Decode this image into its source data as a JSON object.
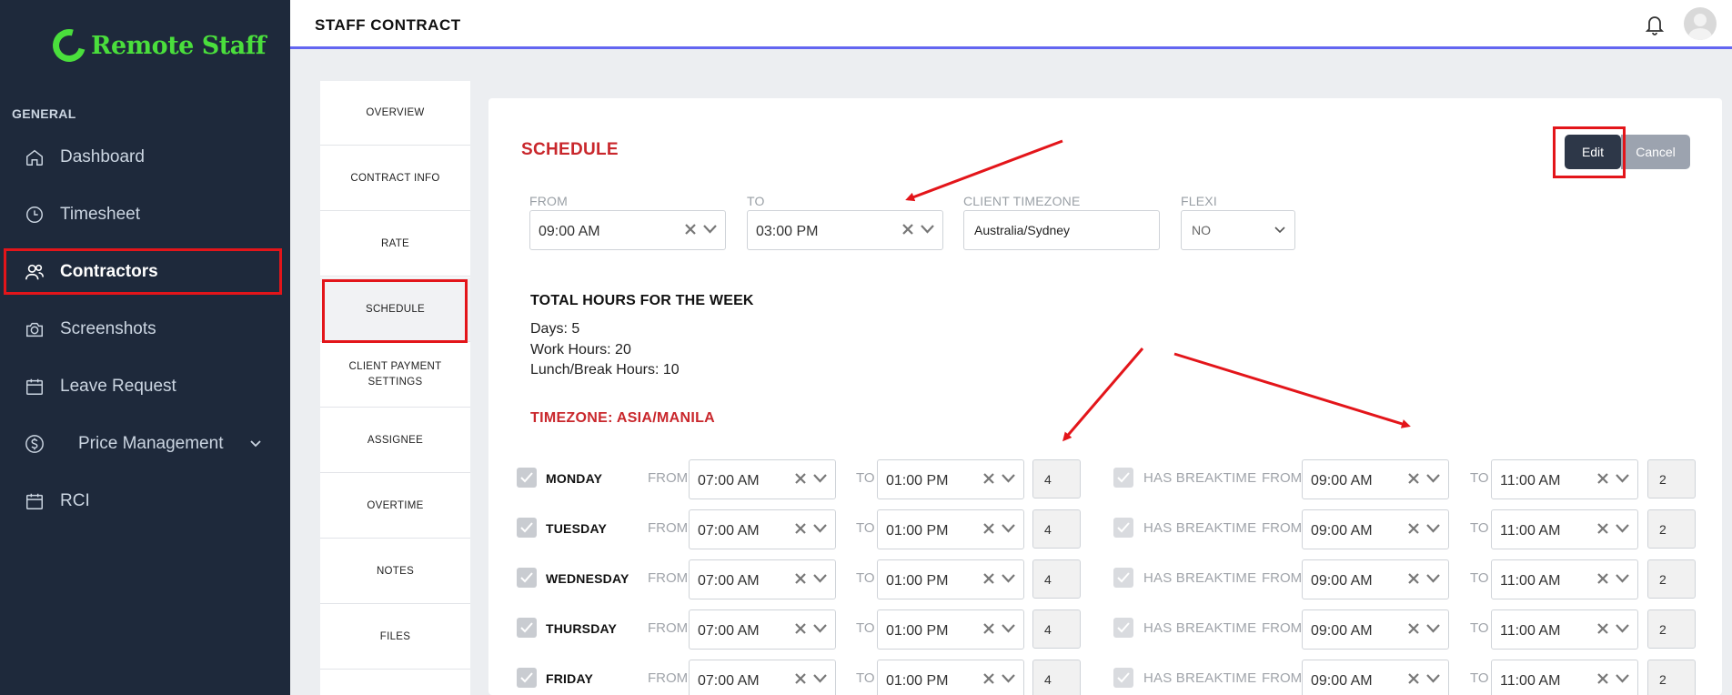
{
  "brand": {
    "name": "Remote Staff",
    "color": "#4ade3c"
  },
  "sidebar": {
    "section": "GENERAL",
    "items": [
      {
        "label": "Dashboard",
        "icon": "home-icon"
      },
      {
        "label": "Timesheet",
        "icon": "clock-icon"
      },
      {
        "label": "Contractors",
        "icon": "users-icon",
        "active": true
      },
      {
        "label": "Screenshots",
        "icon": "camera-icon"
      },
      {
        "label": "Leave Request",
        "icon": "calendar-icon"
      },
      {
        "label": "Price Management",
        "icon": "dollar-icon",
        "has_submenu": true
      },
      {
        "label": "RCI",
        "icon": "calendar-icon"
      }
    ]
  },
  "header": {
    "title": "STAFF CONTRACT"
  },
  "tabs": [
    {
      "label": "OVERVIEW"
    },
    {
      "label": "CONTRACT INFO"
    },
    {
      "label": "RATE"
    },
    {
      "label": "SCHEDULE",
      "active": true
    },
    {
      "label": "CLIENT PAYMENT SETTINGS"
    },
    {
      "label": "ASSIGNEE"
    },
    {
      "label": "OVERTIME"
    },
    {
      "label": "NOTES"
    },
    {
      "label": "FILES"
    }
  ],
  "schedule": {
    "title": "SCHEDULE",
    "edit_label": "Edit",
    "cancel_label": "Cancel",
    "from_label": "FROM",
    "from_value": "09:00 AM",
    "to_label": "TO",
    "to_value": "03:00 PM",
    "client_timezone_label": "CLIENT TIMEZONE",
    "client_timezone_value": "Australia/Sydney",
    "flexi_label": "FLEXI",
    "flexi_value": "NO",
    "totals_title": "TOTAL HOURS FOR THE WEEK",
    "days": "Days: 5",
    "work_hours": "Work Hours: 20",
    "lunch_hours": "Lunch/Break Hours: 10",
    "timezone_title": "TIMEZONE: ASIA/MANILA",
    "row_from_label": "FROM",
    "row_to_label": "TO",
    "has_break_label": "HAS BREAKTIME",
    "rows": [
      {
        "day": "MONDAY",
        "from": "07:00 AM",
        "to": "01:00 PM",
        "hours": "4",
        "break_from": "09:00 AM",
        "break_to": "11:00 AM",
        "break_hours": "2"
      },
      {
        "day": "TUESDAY",
        "from": "07:00 AM",
        "to": "01:00 PM",
        "hours": "4",
        "break_from": "09:00 AM",
        "break_to": "11:00 AM",
        "break_hours": "2"
      },
      {
        "day": "WEDNESDAY",
        "from": "07:00 AM",
        "to": "01:00 PM",
        "hours": "4",
        "break_from": "09:00 AM",
        "break_to": "11:00 AM",
        "break_hours": "2"
      },
      {
        "day": "THURSDAY",
        "from": "07:00 AM",
        "to": "01:00 PM",
        "hours": "4",
        "break_from": "09:00 AM",
        "break_to": "11:00 AM",
        "break_hours": "2"
      },
      {
        "day": "FRIDAY",
        "from": "07:00 AM",
        "to": "01:00 PM",
        "hours": "4",
        "break_from": "09:00 AM",
        "break_to": "11:00 AM",
        "break_hours": "2"
      }
    ]
  },
  "colors": {
    "sidebar_bg": "#1e293b",
    "accent": "#6366f1",
    "annotation": "#e3151a",
    "title_red": "#c9272c"
  }
}
